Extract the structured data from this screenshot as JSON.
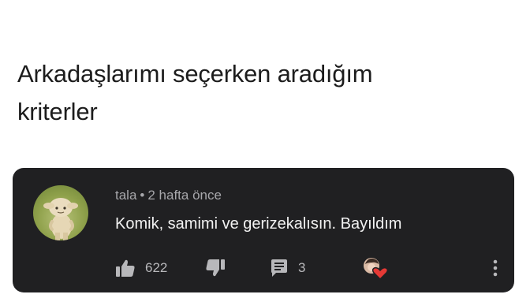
{
  "caption": {
    "line1": "Arkadaşlarımı seçerken aradığım",
    "line2": "kriterler"
  },
  "comment": {
    "author": "tala",
    "separator": "•",
    "time": "2 hafta önce",
    "text": "Komik, samimi ve gerizekalısın. Bayıldım",
    "likes": "622",
    "replies": "3"
  },
  "icons": {
    "avatar": "mushroom-character-avatar",
    "like": "thumbs-up-icon",
    "dislike": "thumbs-down-icon",
    "reply": "comment-icon",
    "creator_heart": "creator-heart-icon",
    "more": "more-vertical-icon"
  },
  "colors": {
    "card_bg": "#202022",
    "text_primary": "#f2f2f2",
    "text_secondary": "#a7a7ab",
    "heart": "#e53935"
  }
}
